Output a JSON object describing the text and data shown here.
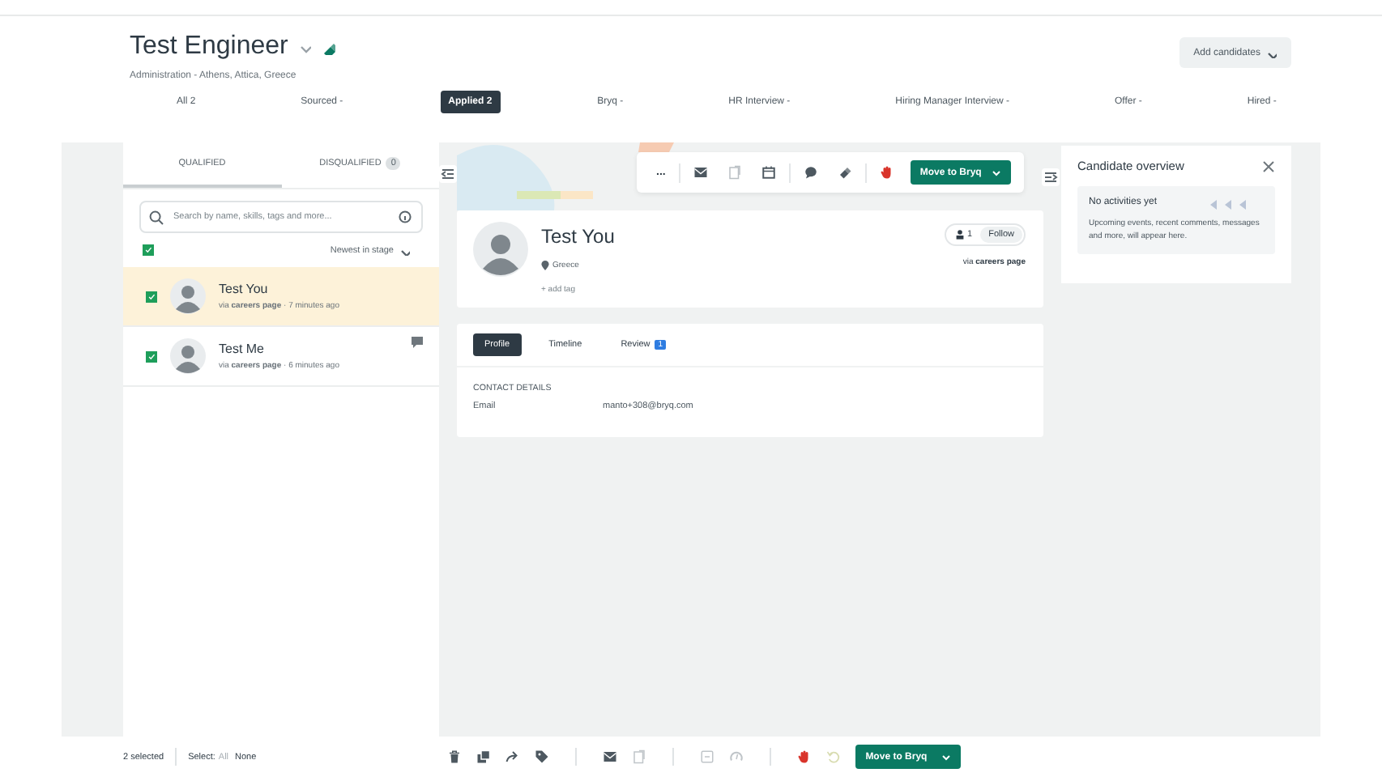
{
  "job": {
    "title": "Test Engineer",
    "subtitle": "Administration - Athens, Attica, Greece"
  },
  "add_candidates": "Add candidates",
  "stages": [
    {
      "label": "All",
      "count": "2",
      "selected": false
    },
    {
      "label": "Sourced",
      "count": "-",
      "selected": false
    },
    {
      "label": "Applied",
      "count": "2",
      "selected": true
    },
    {
      "label": "Bryq",
      "count": "-",
      "selected": false
    },
    {
      "label": "HR Interview",
      "count": "-",
      "selected": false
    },
    {
      "label": "Hiring Manager Interview",
      "count": "-",
      "selected": false
    },
    {
      "label": "Offer",
      "count": "-",
      "selected": false
    },
    {
      "label": "Hired",
      "count": "-",
      "selected": false
    }
  ],
  "list_tabs": [
    {
      "label": "QUALIFIED",
      "selected": true
    },
    {
      "label": "DISQUALIFIED",
      "count": "0",
      "selected": false
    }
  ],
  "search": {
    "placeholder": "Search by name, skills, tags and more..."
  },
  "select_all": {
    "checked": true
  },
  "sort": "Newest in stage",
  "candidates": [
    {
      "name": "Test You",
      "source": "via **careers page** · 7 minutes ago",
      "checked": true,
      "selected": true,
      "has_comment": false
    },
    {
      "name": "Test Me",
      "source": "via **careers page** · 6 minutes ago",
      "checked": true,
      "selected": false,
      "has_comment": true
    }
  ],
  "profile": {
    "more": "...",
    "move_button": "Move to Bryq",
    "name": "Test You",
    "location": "Greece",
    "add_tag": "+ add tag",
    "followers": "1",
    "follow": "Follow",
    "source": "via **careers page**",
    "tabs": [
      {
        "label": "Profile",
        "selected": true
      },
      {
        "label": "Timeline",
        "selected": false
      },
      {
        "label": "Review",
        "count": "1",
        "selected": false
      }
    ],
    "section": "CONTACT DETAILS",
    "fields": [
      {
        "label": "Email",
        "value": "manto+308@bryq.com"
      }
    ]
  },
  "overview": {
    "title": "Candidate overview",
    "empty_title": "No activities yet",
    "empty_text": "Upcoming events, recent comments, messages and more, will appear here."
  },
  "bulk": {
    "selected_count": "2 selected",
    "select_label": "Select:",
    "options": [
      {
        "label": "All",
        "disabled": true
      },
      {
        "label": "None",
        "disabled": false
      }
    ],
    "move_button": "Move to Bryq"
  }
}
